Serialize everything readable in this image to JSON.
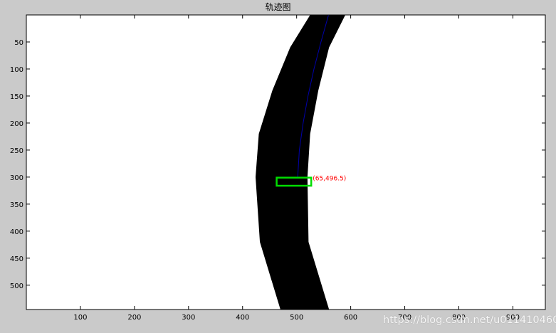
{
  "figure": {
    "title": "轨迹图",
    "watermark": "https://blog.csdn.net/u011410460"
  },
  "axes": {
    "x_ticks": [
      100,
      200,
      300,
      400,
      500,
      600,
      700,
      800,
      900
    ],
    "y_ticks": [
      50,
      100,
      150,
      200,
      250,
      300,
      350,
      400,
      450,
      500
    ],
    "xlim": [
      0,
      960
    ],
    "ylim": [
      0,
      545
    ],
    "y_direction": "reverse",
    "grid": false
  },
  "road": {
    "color": "#000000",
    "background": "#ffffff",
    "left_edge": [
      [
        525,
        0
      ],
      [
        488,
        60
      ],
      [
        455,
        140
      ],
      [
        430,
        220
      ],
      [
        424,
        300
      ],
      [
        432,
        420
      ],
      [
        470,
        545
      ]
    ],
    "right_edge": [
      [
        590,
        0
      ],
      [
        560,
        60
      ],
      [
        540,
        140
      ],
      [
        525,
        220
      ],
      [
        520,
        300
      ],
      [
        522,
        420
      ],
      [
        560,
        545
      ]
    ]
  },
  "trajectory": {
    "color": "#0000aa",
    "points": [
      [
        559,
        0
      ],
      [
        545,
        50
      ],
      [
        532,
        100
      ],
      [
        521,
        150
      ],
      [
        512,
        200
      ],
      [
        505,
        250
      ],
      [
        502,
        300
      ]
    ]
  },
  "marker_box": {
    "color": "#00dd00",
    "x": [
      463,
      527
    ],
    "y": [
      301,
      316
    ],
    "label": "(65,496.5)",
    "label_color": "#ff0000"
  }
}
